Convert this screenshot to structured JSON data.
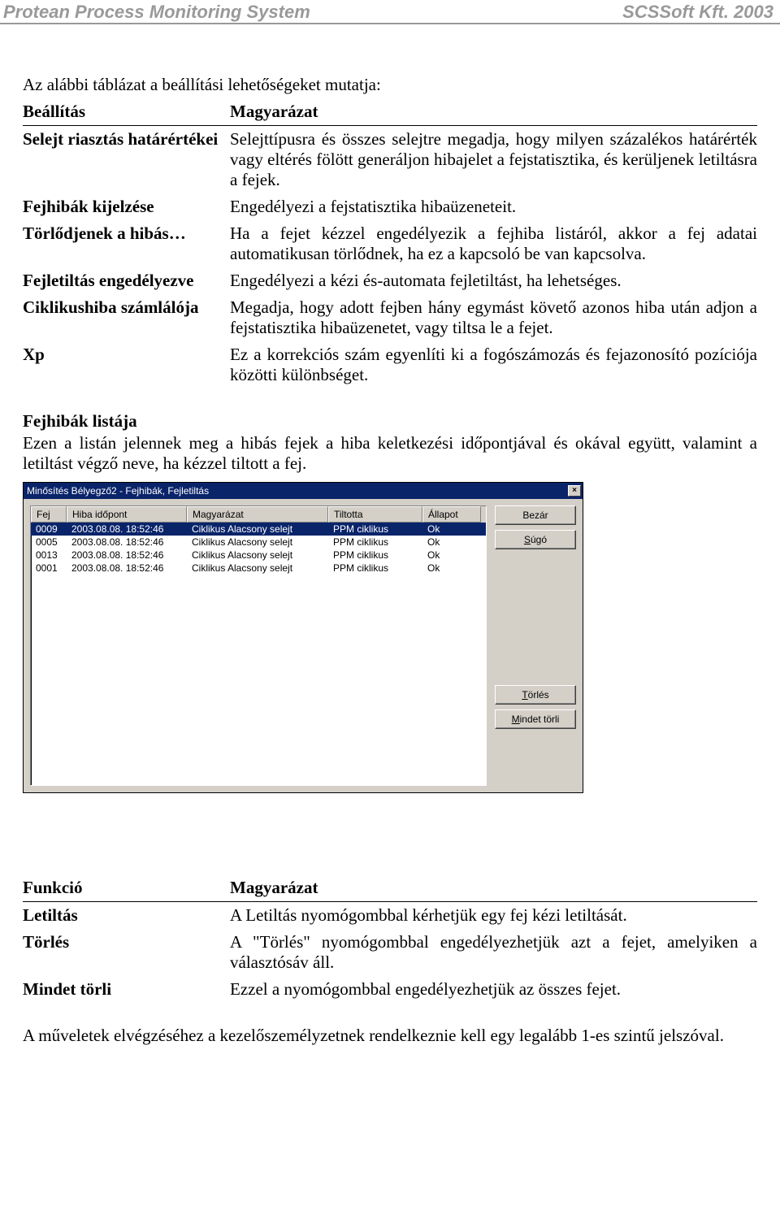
{
  "header": {
    "left": "Protean Process Monitoring System",
    "right": "SCSSoft Kft. 2003"
  },
  "intro": "Az alábbi táblázat a beállítási lehetőségeket mutatja:",
  "settings": {
    "head_key": "Beállítás",
    "head_val": "Magyarázat",
    "rows": [
      {
        "k": "Selejt riasztás határértékei",
        "v": "Selejttípusra és összes selejtre megadja, hogy milyen százalékos határérték vagy eltérés fölött generáljon hibajelet a fejstatisztika, és kerüljenek letiltásra a fejek."
      },
      {
        "k": "Fejhibák kijelzése",
        "v": "Engedélyezi a fejstatisztika hibaüzeneteit."
      },
      {
        "k": "Törlődjenek a hibás…",
        "v": "Ha a fejet kézzel engedélyezik a fejhiba listáról, akkor a fej adatai automatikusan törlődnek, ha ez a kapcsoló be van kapcsolva."
      },
      {
        "k": "Fejletiltás engedélyezve",
        "v": "Engedélyezi a kézi és-automata fejletiltást, ha lehetséges."
      },
      {
        "k": "Ciklikushiba számlálója",
        "v": "Megadja, hogy adott fejben hány egymást követő azonos hiba után adjon a fejstatisztika hibaüzenetet, vagy tiltsa le a fejet."
      },
      {
        "k": "Xp",
        "v": "Ez a korrekciós szám egyenlíti ki a fogószámozás és fejazonosító pozíciója közötti különbséget."
      }
    ]
  },
  "section2": {
    "title": "Fejhibák listája",
    "body": "Ezen a listán jelennek meg a hibás fejek a hiba keletkezési időpontjával és okával együtt, valamint a letiltást végző neve, ha kézzel tiltott a fej."
  },
  "dialog": {
    "title": "Minősítés Bélyegző2 - Fejhibák, Fejletiltás",
    "close_x": "×",
    "columns": {
      "fej": "Fej",
      "ido": "Hiba időpont",
      "magy": "Magyarázat",
      "tilt": "Tiltotta",
      "all": "Állapot"
    },
    "rows": [
      {
        "fej": "0009",
        "ido": "2003.08.08. 18:52:46",
        "magy": "Ciklikus Alacsony selejt",
        "tilt": "PPM ciklikus",
        "all": "Ok",
        "selected": true
      },
      {
        "fej": "0005",
        "ido": "2003.08.08. 18:52:46",
        "magy": "Ciklikus Alacsony selejt",
        "tilt": "PPM ciklikus",
        "all": "Ok",
        "selected": false
      },
      {
        "fej": "0013",
        "ido": "2003.08.08. 18:52:46",
        "magy": "Ciklikus Alacsony selejt",
        "tilt": "PPM ciklikus",
        "all": "Ok",
        "selected": false
      },
      {
        "fej": "0001",
        "ido": "2003.08.08. 18:52:46",
        "magy": "Ciklikus Alacsony selejt",
        "tilt": "PPM ciklikus",
        "all": "Ok",
        "selected": false
      }
    ],
    "buttons": {
      "bezar": "Bezár",
      "sugo": "Súgó",
      "torles": "Törlés",
      "mindet": "Mindet törli"
    }
  },
  "functions": {
    "head_key": "Funkció",
    "head_val": "Magyarázat",
    "rows": [
      {
        "k": "Letiltás",
        "v": "A Letiltás nyomógombbal kérhetjük egy fej kézi letiltását."
      },
      {
        "k": "Törlés",
        "v": "A \"Törlés\" nyomógombbal engedélyezhetjük azt a fejet, amelyiken a választósáv áll."
      },
      {
        "k": "Mindet törli",
        "v": "Ezzel a nyomógombbal engedélyezhetjük az összes fejet."
      }
    ]
  },
  "footer_note": "A műveletek elvégzéséhez a kezelőszemélyzetnek rendelkeznie kell egy legalább 1-es szintű jelszóval."
}
